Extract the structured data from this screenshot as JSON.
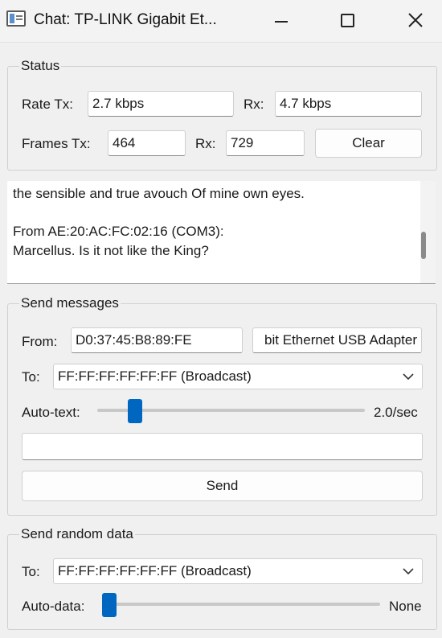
{
  "window": {
    "title": "Chat: TP-LINK Gigabit Et..."
  },
  "status": {
    "legend": "Status",
    "rate_tx_label": "Rate Tx:",
    "rate_tx_value": "2.7 kbps",
    "rate_rx_label": "Rx:",
    "rate_rx_value": "4.7 kbps",
    "frames_tx_label": "Frames Tx:",
    "frames_tx_value": "464",
    "frames_rx_label": "Rx:",
    "frames_rx_value": "729",
    "clear_label": "Clear"
  },
  "chat": {
    "lines": [
      "the sensible and true avouch Of mine own eyes.",
      "",
      "From AE:20:AC:FC:02:16 (COM3):",
      "Marcellus. Is it not like the King?"
    ],
    "scroll_position": 0.85
  },
  "send_messages": {
    "legend": "Send messages",
    "from_label": "From:",
    "from_address": "D0:37:45:B8:89:FE",
    "from_adapter": "bit Ethernet USB Adapter",
    "to_label": "To:",
    "to_value": "FF:FF:FF:FF:FF:FF (Broadcast)",
    "auto_text_label": "Auto-text:",
    "auto_text_value": "2.0/sec",
    "auto_text_level": 0.12,
    "message_input": "",
    "send_label": "Send"
  },
  "send_random": {
    "legend": "Send random data",
    "to_label": "To:",
    "to_value": "FF:FF:FF:FF:FF:FF (Broadcast)",
    "auto_data_label": "Auto-data:",
    "auto_data_value": "None",
    "auto_data_level": 0
  },
  "icons": {
    "app": "chat-window-icon",
    "minimize": "minimize-icon",
    "maximize": "maximize-icon",
    "close": "close-icon",
    "dropdown": "chevron-down-icon"
  },
  "colors": {
    "accent": "#0067c0"
  }
}
